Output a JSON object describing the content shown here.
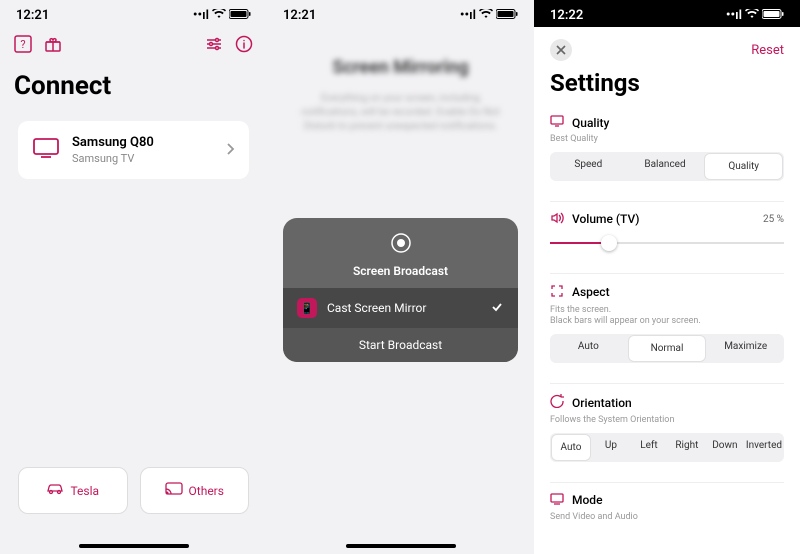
{
  "screen1": {
    "time": "12:21",
    "title": "Connect",
    "device": {
      "name": "Samsung Q80",
      "type": "Samsung TV"
    },
    "bottom": {
      "tesla": "Tesla",
      "others": "Others"
    }
  },
  "screen2": {
    "time": "12:21",
    "notice": "Everything on your screen, including notifications, will be recorded. Enable Do Not Disturb to prevent unexpected notifications.",
    "broadcast": {
      "title": "Screen Broadcast",
      "app": "Cast Screen Mirror",
      "start": "Start Broadcast"
    }
  },
  "screen3": {
    "time": "12:22",
    "reset": "Reset",
    "title": "Settings",
    "quality": {
      "label": "Quality",
      "sub": "Best Quality",
      "opts": {
        "speed": "Speed",
        "balanced": "Balanced",
        "quality": "Quality"
      }
    },
    "volume": {
      "label": "Volume (TV)",
      "value": "25 %"
    },
    "aspect": {
      "label": "Aspect",
      "sub1": "Fits the screen.",
      "sub2": "Black bars will appear on your screen.",
      "opts": {
        "auto": "Auto",
        "normal": "Normal",
        "maximize": "Maximize"
      }
    },
    "orientation": {
      "label": "Orientation",
      "sub": "Follows the System Orientation",
      "opts": {
        "auto": "Auto",
        "up": "Up",
        "left": "Left",
        "right": "Right",
        "down": "Down",
        "inverted": "Inverted"
      }
    },
    "mode": {
      "label": "Mode",
      "sub": "Send Video and Audio"
    }
  }
}
